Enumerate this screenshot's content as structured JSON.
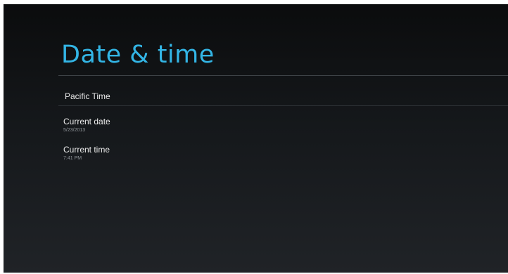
{
  "page": {
    "title": "Date & time",
    "accent_color": "#33b5e5"
  },
  "timezone": {
    "label": "Pacific Time"
  },
  "current_date": {
    "title": "Current date",
    "value": "5/23/2013"
  },
  "current_time": {
    "title": "Current time",
    "value": "7:41 PM"
  }
}
